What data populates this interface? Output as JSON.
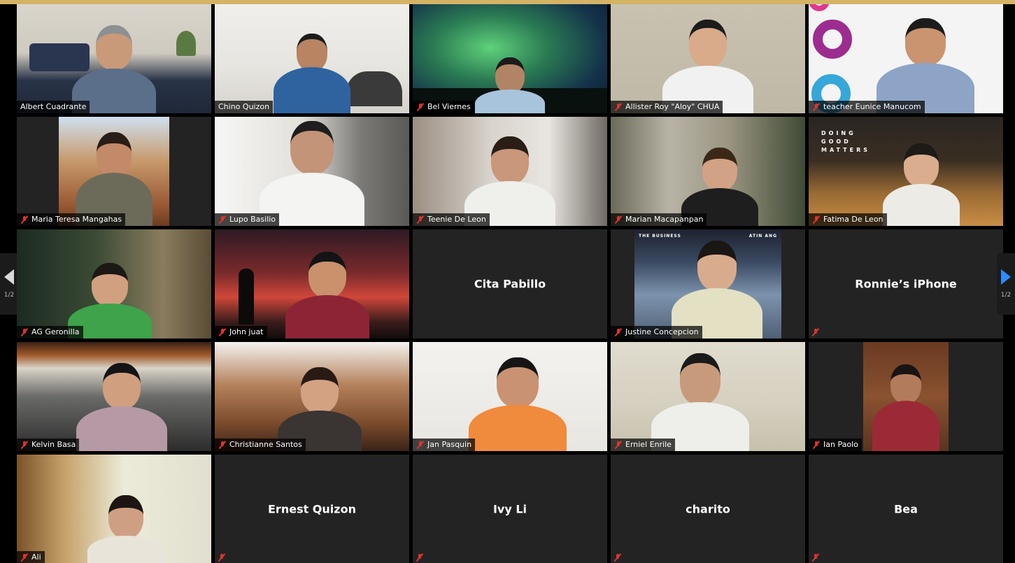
{
  "meeting": {
    "page_indicator": "1/2",
    "participants": [
      {
        "name": "Albert Cuadrante",
        "muted": false,
        "active_speaker": false,
        "video": true
      },
      {
        "name": "Chino Quizon",
        "muted": false,
        "active_speaker": true,
        "video": true
      },
      {
        "name": "Bel Viernes",
        "muted": true,
        "active_speaker": false,
        "video": true
      },
      {
        "name": "Allister Roy \"Aloy\" CHUA",
        "muted": true,
        "active_speaker": false,
        "video": true
      },
      {
        "name": "teacher Eunice Manucom",
        "muted": true,
        "active_speaker": false,
        "video": true
      },
      {
        "name": "Maria Teresa Mangahas",
        "muted": true,
        "active_speaker": false,
        "video": true
      },
      {
        "name": "Lupo Basilio",
        "muted": true,
        "active_speaker": false,
        "video": true
      },
      {
        "name": "Teenie De Leon",
        "muted": true,
        "active_speaker": false,
        "video": true
      },
      {
        "name": "Marian Macapanpan",
        "muted": true,
        "active_speaker": false,
        "video": true
      },
      {
        "name": "Fatima De Leon",
        "muted": true,
        "active_speaker": false,
        "video": true
      },
      {
        "name": "AG Geronilla",
        "muted": true,
        "active_speaker": false,
        "video": true
      },
      {
        "name": "John juat",
        "muted": true,
        "active_speaker": false,
        "video": true
      },
      {
        "name": "Cita Pabillo",
        "muted": false,
        "active_speaker": false,
        "video": false
      },
      {
        "name": "Justine Concepcion",
        "muted": true,
        "active_speaker": false,
        "video": true
      },
      {
        "name": "Ronnie’s iPhone",
        "muted": true,
        "active_speaker": false,
        "video": false
      },
      {
        "name": "Kelvin Basa",
        "muted": true,
        "active_speaker": false,
        "video": true
      },
      {
        "name": "Christianne Santos",
        "muted": true,
        "active_speaker": false,
        "video": true
      },
      {
        "name": "Jan Pasquin",
        "muted": true,
        "active_speaker": false,
        "video": true
      },
      {
        "name": "Erniel Enrile",
        "muted": true,
        "active_speaker": false,
        "video": true
      },
      {
        "name": "Ian Paolo",
        "muted": true,
        "active_speaker": false,
        "video": true
      },
      {
        "name": "Ali",
        "muted": true,
        "active_speaker": false,
        "video": true
      },
      {
        "name": "Ernest Quizon",
        "muted": true,
        "active_speaker": false,
        "video": false
      },
      {
        "name": "Ivy Li",
        "muted": true,
        "active_speaker": false,
        "video": false
      },
      {
        "name": "charito",
        "muted": true,
        "active_speaker": false,
        "video": false
      },
      {
        "name": "Bea",
        "muted": true,
        "active_speaker": false,
        "video": false
      }
    ],
    "virtual_backgrounds": {
      "fatima": [
        "DOING",
        "GOOD",
        "MATTERS"
      ],
      "justine_left": "THE BUSINESS",
      "justine_right": "ATIN ANG"
    }
  },
  "colors": {
    "top_bar": "#d4b366",
    "active_speaker_border": "#e5d97a",
    "tile_background": "#232323",
    "mute_icon": "#e0332f",
    "next_arrow": "#2d8cff",
    "prev_arrow": "#d9d9d9"
  }
}
